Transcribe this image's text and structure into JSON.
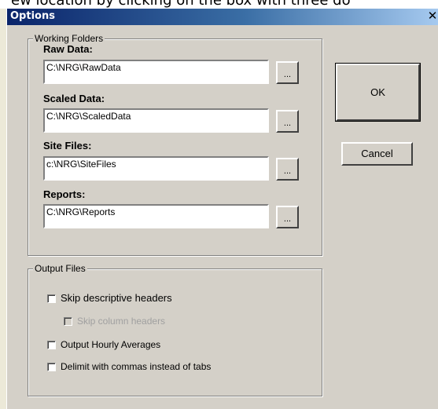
{
  "background_caption": "ew location by clicking on the box with three do",
  "window": {
    "title": "Options",
    "close_glyph": "✕",
    "titlebar_color": "#0a246a"
  },
  "working_folders": {
    "legend": "Working Folders",
    "fields": [
      {
        "label": "Raw Data:",
        "value": "C:\\NRG\\RawData",
        "browse_label": "..."
      },
      {
        "label": "Scaled Data:",
        "value": "C:\\NRG\\ScaledData",
        "browse_label": "..."
      },
      {
        "label": "Site Files:",
        "value": "c:\\NRG\\SiteFiles",
        "browse_label": "..."
      },
      {
        "label": "Reports:",
        "value": "C:\\NRG\\Reports",
        "browse_label": "..."
      }
    ]
  },
  "buttons": {
    "ok": "OK",
    "cancel": "Cancel"
  },
  "output_files": {
    "legend": "Output Files",
    "options": [
      {
        "label": "Skip descriptive headers",
        "checked": false,
        "enabled": true
      },
      {
        "label": "Skip column headers",
        "checked": false,
        "enabled": false
      },
      {
        "label": "Output Hourly Averages",
        "checked": false,
        "enabled": true
      },
      {
        "label": "Delimit with commas instead of tabs",
        "checked": false,
        "enabled": true
      }
    ]
  }
}
